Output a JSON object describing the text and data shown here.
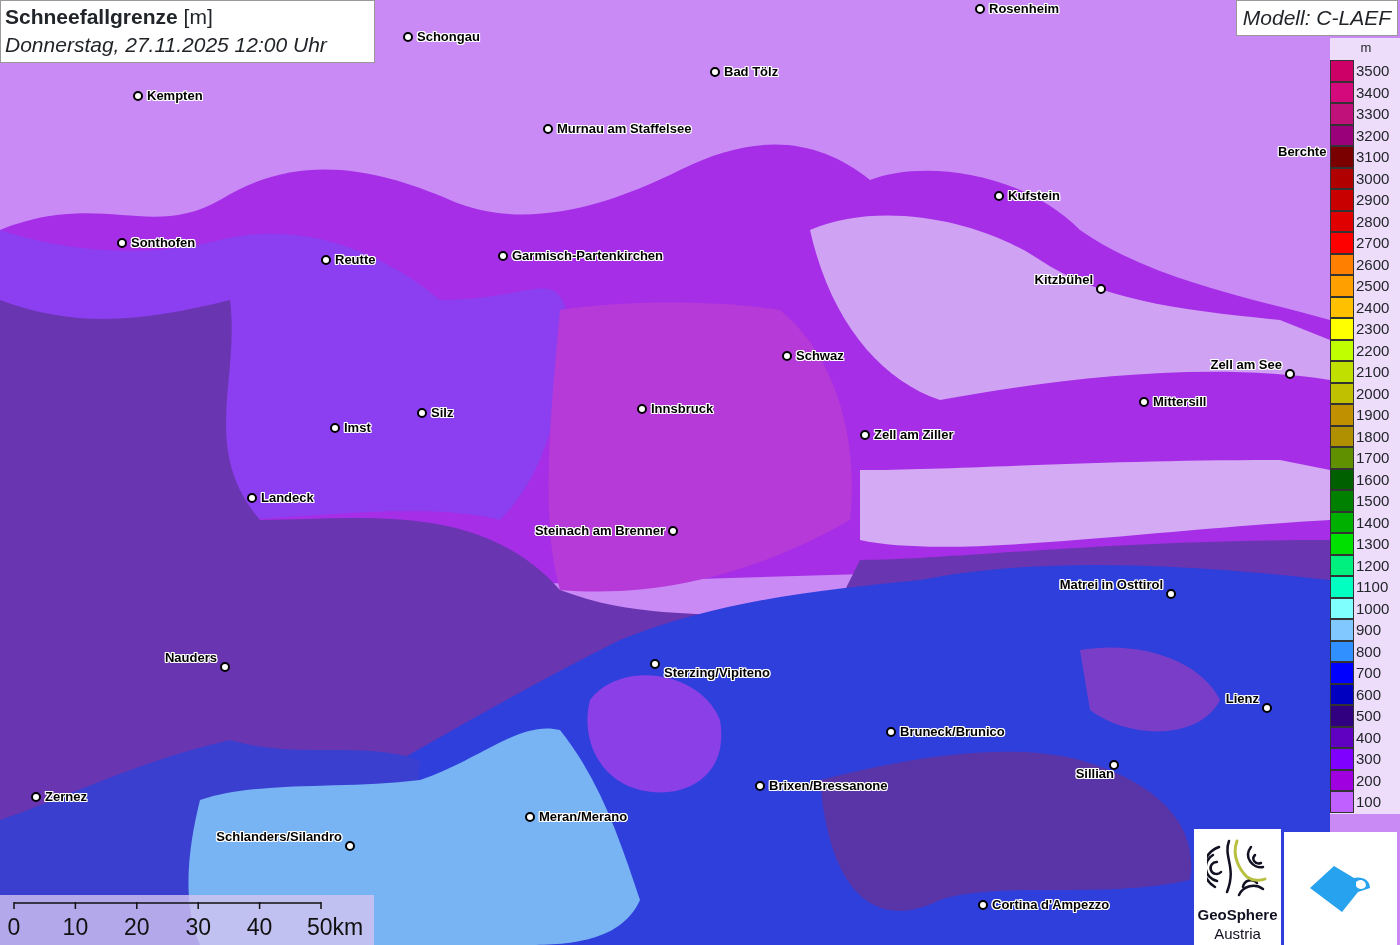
{
  "title": {
    "parameter": "**Schneefallgrenze** [m]",
    "valid_time": "Donnerstag, 27.11.2025 12:00 Uhr"
  },
  "model": "Modell: C-LAEF",
  "cities": [
    {
      "name": "Rosenheim"
    },
    {
      "name": "Schongau"
    },
    {
      "name": "Kempten"
    },
    {
      "name": "Bad Tölz"
    },
    {
      "name": "Murnau am Staffelsee"
    },
    {
      "name": "Berchte"
    },
    {
      "name": "Kufstein"
    },
    {
      "name": "Sonthofen"
    },
    {
      "name": "Reutte"
    },
    {
      "name": "Garmisch-Partenkirchen"
    },
    {
      "name": "Kitzbühel"
    },
    {
      "name": "Schwaz"
    },
    {
      "name": "Zell am See"
    },
    {
      "name": "Innsbruck"
    },
    {
      "name": "Mittersill"
    },
    {
      "name": "Silz"
    },
    {
      "name": "Imst"
    },
    {
      "name": "Zell am Ziller"
    },
    {
      "name": "Landeck"
    },
    {
      "name": "Steinach am Brenner"
    },
    {
      "name": "Matrei in Osttirol"
    },
    {
      "name": "Nauders"
    },
    {
      "name": "Sterzing/Vipiteno"
    },
    {
      "name": "Lienz"
    },
    {
      "name": "Bruneck/Brunico"
    },
    {
      "name": "Sillian"
    },
    {
      "name": "Brixen/Bressanone"
    },
    {
      "name": "Zernez"
    },
    {
      "name": "Meran/Merano"
    },
    {
      "name": "Schlanders/Silandro"
    },
    {
      "name": "Cortina d'Ampezzo"
    }
  ],
  "legend": {
    "unit": "m",
    "items": [
      {
        "label": "3500",
        "color": "#cc0066"
      },
      {
        "label": "3400",
        "color": "#d40a7c"
      },
      {
        "label": "3300",
        "color": "#c0107a"
      },
      {
        "label": "3200",
        "color": "#99007a"
      },
      {
        "label": "3100",
        "color": "#7a0000"
      },
      {
        "label": "3000",
        "color": "#b00000"
      },
      {
        "label": "2900",
        "color": "#c80000"
      },
      {
        "label": "2800",
        "color": "#e00000"
      },
      {
        "label": "2700",
        "color": "#ff0000"
      },
      {
        "label": "2600",
        "color": "#ff8000"
      },
      {
        "label": "2500",
        "color": "#ffa000"
      },
      {
        "label": "2400",
        "color": "#ffc000"
      },
      {
        "label": "2300",
        "color": "#ffff00"
      },
      {
        "label": "2200",
        "color": "#c0ff00"
      },
      {
        "label": "2100",
        "color": "#c0e000"
      },
      {
        "label": "2000",
        "color": "#c0c000"
      },
      {
        "label": "1900",
        "color": "#c09000"
      },
      {
        "label": "1800",
        "color": "#b09000"
      },
      {
        "label": "1700",
        "color": "#609000"
      },
      {
        "label": "1600",
        "color": "#006000"
      },
      {
        "label": "1500",
        "color": "#008000"
      },
      {
        "label": "1400",
        "color": "#00b000"
      },
      {
        "label": "1300",
        "color": "#00e000"
      },
      {
        "label": "1200",
        "color": "#00f080"
      },
      {
        "label": "1100",
        "color": "#00ffc0"
      },
      {
        "label": "1000",
        "color": "#80ffff"
      },
      {
        "label": "900",
        "color": "#80c8ff"
      },
      {
        "label": "800",
        "color": "#3090ff"
      },
      {
        "label": "700",
        "color": "#0000ff"
      },
      {
        "label": "600",
        "color": "#0000c0"
      },
      {
        "label": "500",
        "color": "#300080"
      },
      {
        "label": "400",
        "color": "#6000c0"
      },
      {
        "label": "300",
        "color": "#8000ff"
      },
      {
        "label": "200",
        "color": "#a000e0"
      },
      {
        "label": "100",
        "color": "#c060ff"
      }
    ]
  },
  "scale_bar": {
    "ticks": [
      "0",
      "10",
      "20",
      "30",
      "40",
      "50km"
    ]
  },
  "logos": {
    "geosphere_name": "GeoSphere",
    "geosphere_country": "Austria"
  }
}
